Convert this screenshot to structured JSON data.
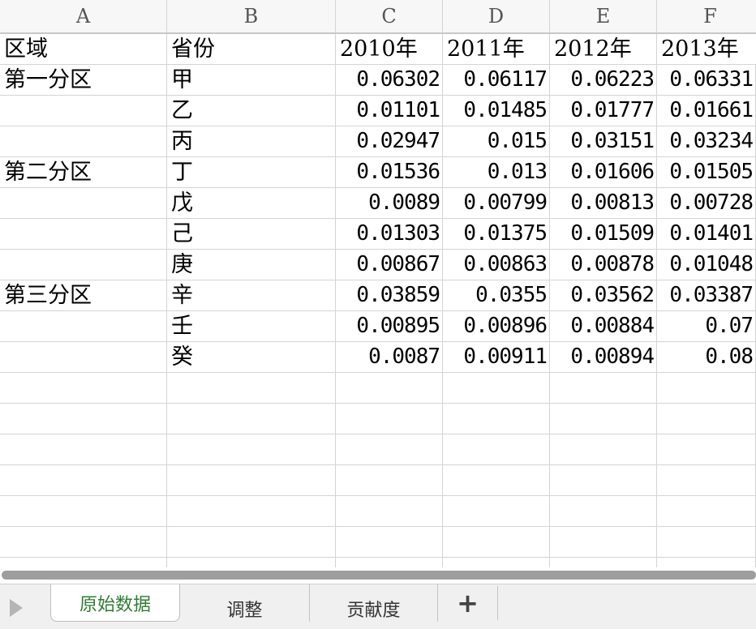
{
  "columns": [
    "A",
    "B",
    "C",
    "D",
    "E",
    "F"
  ],
  "header_row": [
    "区域",
    "省份",
    "2010年",
    "2011年",
    "2012年",
    "2013年"
  ],
  "rows": [
    [
      "第一分区",
      "甲",
      "0.06302",
      "0.06117",
      "0.06223",
      "0.06331"
    ],
    [
      "",
      "乙",
      "0.01101",
      "0.01485",
      "0.01777",
      "0.01661"
    ],
    [
      "",
      "丙",
      "0.02947",
      "0.015",
      "0.03151",
      "0.03234"
    ],
    [
      "第二分区",
      "丁",
      "0.01536",
      "0.013",
      "0.01606",
      "0.01505"
    ],
    [
      "",
      "戊",
      "0.0089",
      "0.00799",
      "0.00813",
      "0.00728"
    ],
    [
      "",
      "己",
      "0.01303",
      "0.01375",
      "0.01509",
      "0.01401"
    ],
    [
      "",
      "庚",
      "0.00867",
      "0.00863",
      "0.00878",
      "0.01048"
    ],
    [
      "第三分区",
      "辛",
      "0.03859",
      "0.0355",
      "0.03562",
      "0.03387"
    ],
    [
      "",
      "壬",
      "0.00895",
      "0.00896",
      "0.00884",
      "0.07"
    ],
    [
      "",
      "癸",
      "0.0087",
      "0.00911",
      "0.00894",
      "0.08"
    ]
  ],
  "empty_rows": 7,
  "sheet_tabs": [
    {
      "label": "原始数据",
      "active": true
    },
    {
      "label": "调整",
      "active": false
    },
    {
      "label": "贡献度",
      "active": false
    }
  ],
  "add_sheet_label": "+",
  "active_tab_color": "#2e7d32"
}
